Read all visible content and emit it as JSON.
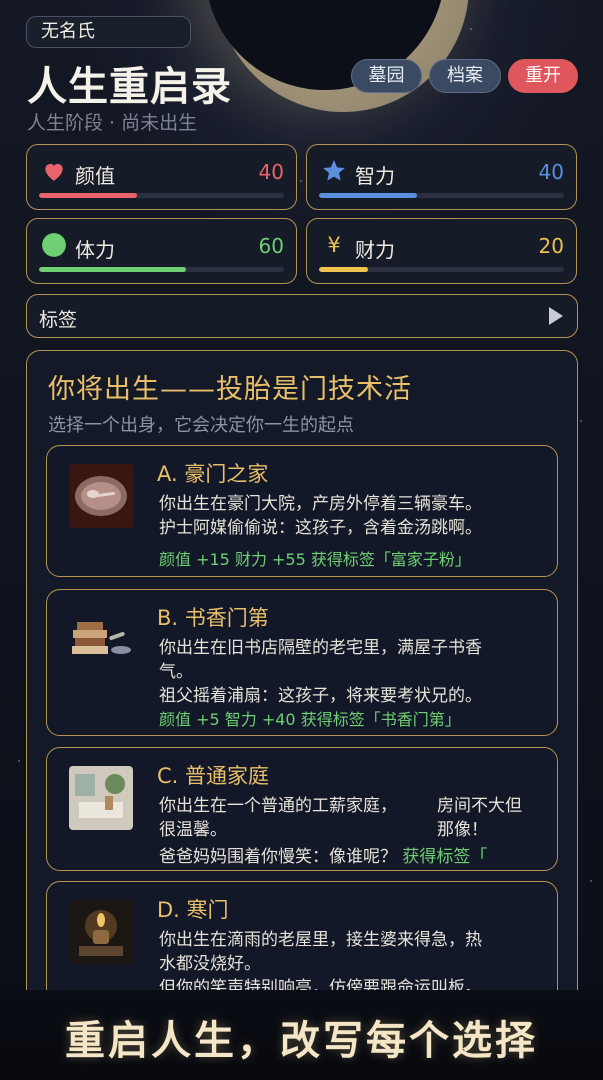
{
  "player": {
    "name": "无名氏"
  },
  "header": {
    "title": "人生重启录",
    "stage": "人生阶段 · 尚未出生",
    "buttons": {
      "graveyard": "墓园",
      "archive": "档案",
      "restart": "重开"
    }
  },
  "stats": {
    "appearance": {
      "label": "颜值",
      "value": "40",
      "max": 100,
      "color": "#e8646a",
      "icon": "heart-icon"
    },
    "intelligence": {
      "label": "智力",
      "value": "40",
      "max": 100,
      "color": "#5b8fe0",
      "icon": "star-icon"
    },
    "stamina": {
      "label": "体力",
      "value": "60",
      "max": 100,
      "color": "#6fcf73",
      "icon": "circle-icon"
    },
    "wealth": {
      "label": "财力",
      "value": "20",
      "max": 100,
      "color": "#eec24f",
      "icon": "yen-icon",
      "icon_glyph": "¥"
    }
  },
  "tags": {
    "label": "标签"
  },
  "panel": {
    "title": "你将出生——投胎是门技术活",
    "subtitle": "选择一个出身，它会决定你一生的起点",
    "options": [
      {
        "title": "A. 豪门之家",
        "desc_line1": "你出生在豪门大院，产房外停着三辆豪车。",
        "desc_line2": "护士阿媒偷偷说：这孩子，含着金汤跳啊。",
        "effect": "颜值 +15 财力 +55 获得标签「富家子粉」",
        "thumb_icon": "silver-spoon-plate-icon"
      },
      {
        "title": "B. 书香门第",
        "desc_line1": "你出生在旧书店隔壁的老宅里，满屋子书香",
        "desc_line2": "气。",
        "desc_line3": "祖父摇着浦扇：这孩子，将来要考状兄的。",
        "effect": "颜值 +5 智力 +40 获得标签「书香门第」",
        "thumb_icon": "books-scroll-icon"
      },
      {
        "title": "C. 普通家庭",
        "desc_line1": "你出生在一个普通的工薪家庭，",
        "desc_line2": "很温馨。",
        "right_line1": "房间不大但",
        "right_line2": "那像！",
        "line3_text": "爸爸妈妈围着你慢笑：像谁呢？",
        "line3_effect": "获得标签「",
        "thumb_icon": "cozy-room-icon"
      },
      {
        "title": "D. 寒门",
        "desc_line1": "你出生在滴雨的老屋里，接生婆来得急，热",
        "desc_line2": "水都没烧好。",
        "desc_line3": "但你的笑声特别响亮，仿傍要跟命运叫板。",
        "thumb_icon": "oil-lamp-icon"
      }
    ]
  },
  "banner": {
    "text": "重启人生，改写每个选择"
  }
}
